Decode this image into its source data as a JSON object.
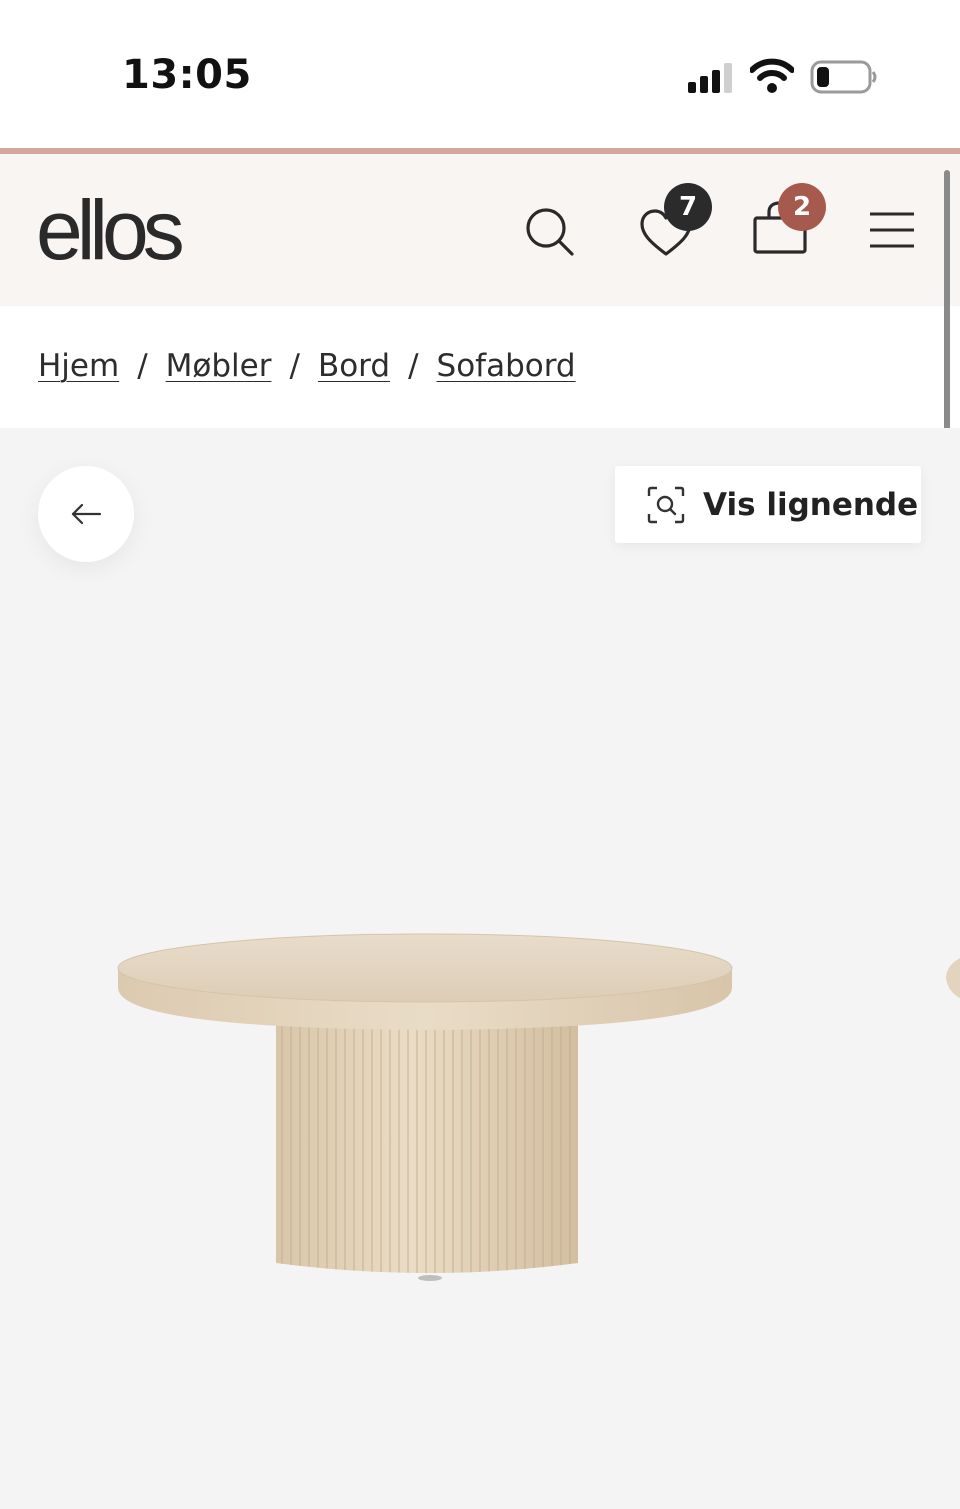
{
  "status_bar": {
    "time": "13:05"
  },
  "header": {
    "logo": "ellos",
    "wishlist_count": "7",
    "cart_count": "2",
    "icons": [
      "search-icon",
      "heart-icon",
      "bag-icon",
      "menu-icon"
    ]
  },
  "breadcrumb": {
    "items": [
      "Hjem",
      "Møbler",
      "Bord",
      "Sofabord"
    ],
    "separator": "/"
  },
  "gallery": {
    "similar_label": "Vis lignende",
    "back_icon": "arrow-left-icon",
    "scan_icon": "visual-search-icon"
  },
  "colors": {
    "accent_rule": "#d3a79c",
    "header_bg": "#f9f5f3",
    "cart_badge": "#a6594d",
    "wishlist_badge": "#2b2b2b",
    "gallery_bg": "#f4f4f4"
  }
}
